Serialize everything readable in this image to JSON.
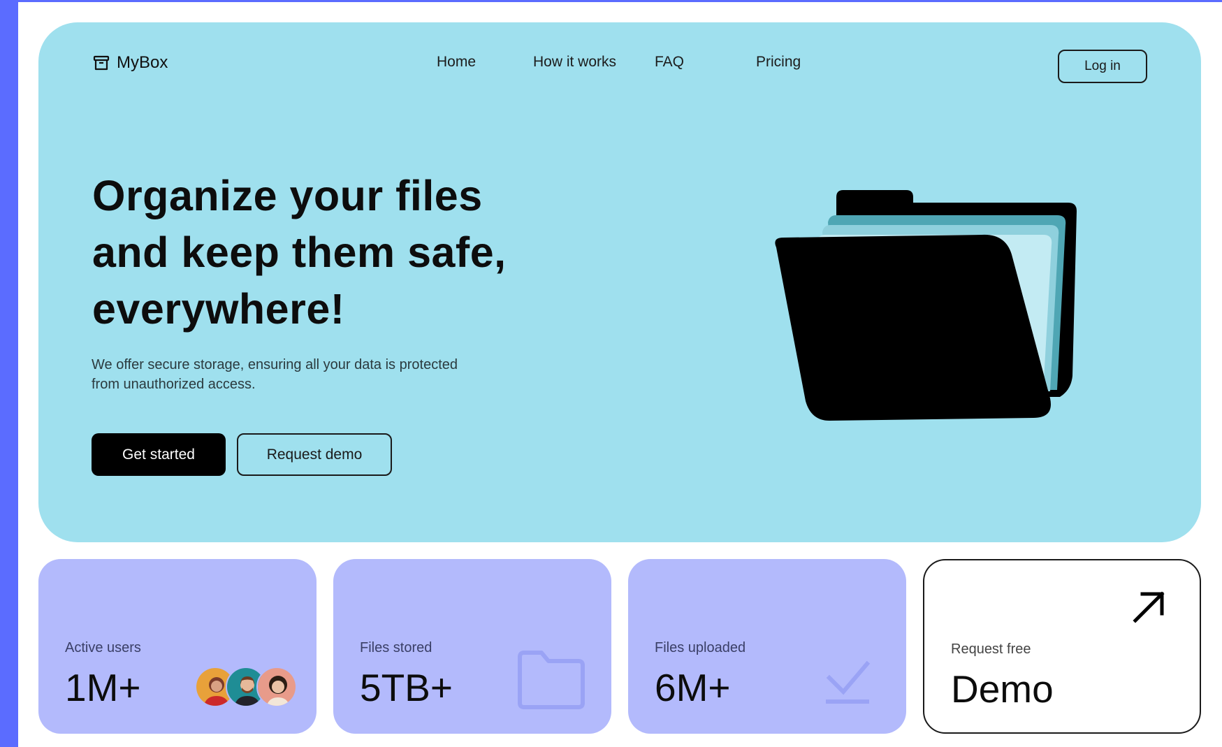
{
  "app": {
    "logo_text": "MyBox",
    "logo_icon": "archive-box-icon"
  },
  "nav": {
    "items": [
      {
        "label": "Home"
      },
      {
        "label": "How it works"
      },
      {
        "label": "FAQ"
      },
      {
        "label": "Pricing"
      }
    ],
    "login_label": "Log in"
  },
  "hero": {
    "headline_line1": "Organize your files",
    "headline_line2": "and keep them safe,",
    "headline_line3": "everywhere!",
    "subtext_line1": "We offer secure storage, ensuring all your data is protected",
    "subtext_line2": "from unauthorized access.",
    "primary_cta": "Get started",
    "secondary_cta": "Request demo",
    "illustration": "open-folder-icon"
  },
  "stats": [
    {
      "label": "Active users",
      "value": "1M+",
      "icon": "user-avatars"
    },
    {
      "label": "Files stored",
      "value": "5TB+",
      "icon": "folder-icon"
    },
    {
      "label": "Files uploaded",
      "value": "6M+",
      "icon": "checkmark-icon"
    }
  ],
  "demo_card": {
    "label": "Request free",
    "value": "Demo",
    "icon": "arrow-up-right-icon"
  },
  "colors": {
    "page_border": "#5b6cff",
    "hero_bg": "#9fe0ee",
    "stat_card_bg": "#b3bafc",
    "stat_icon": "#9aa3f5",
    "primary_button": "#000000"
  }
}
